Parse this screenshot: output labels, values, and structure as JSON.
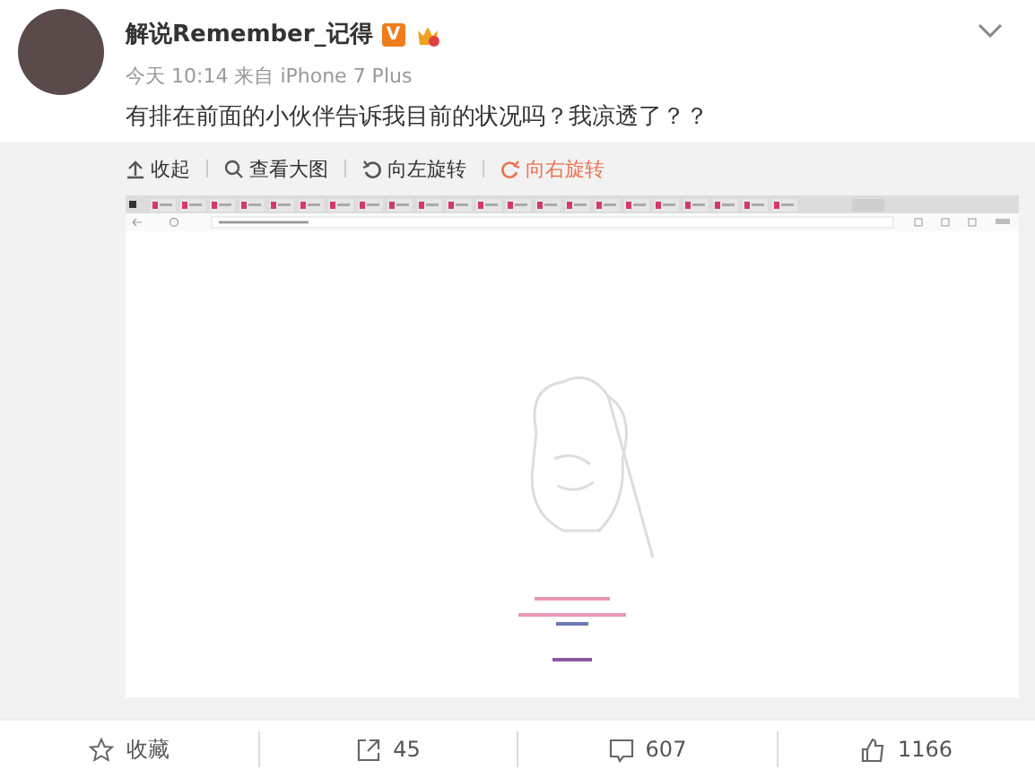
{
  "post": {
    "author": "解说Remember_记得",
    "badge": "V",
    "meta": "今天 10:14 来自 iPhone 7 Plus",
    "text": "有排在前面的小伙伴告诉我目前的状况吗？我凉透了？？"
  },
  "image_toolbar": [
    {
      "kind": "collapse",
      "label": "收起",
      "selected": false
    },
    {
      "kind": "zoom",
      "label": "查看大图",
      "selected": false
    },
    {
      "kind": "rotate-left",
      "label": "向左旋转",
      "selected": false
    },
    {
      "kind": "rotate-right",
      "label": "向右旋转",
      "selected": true
    }
  ],
  "footer_actions": [
    {
      "kind": "favorite",
      "label": "收藏"
    },
    {
      "kind": "repost",
      "label": "45"
    },
    {
      "kind": "comment",
      "label": "607"
    },
    {
      "kind": "like",
      "label": "1166"
    }
  ]
}
